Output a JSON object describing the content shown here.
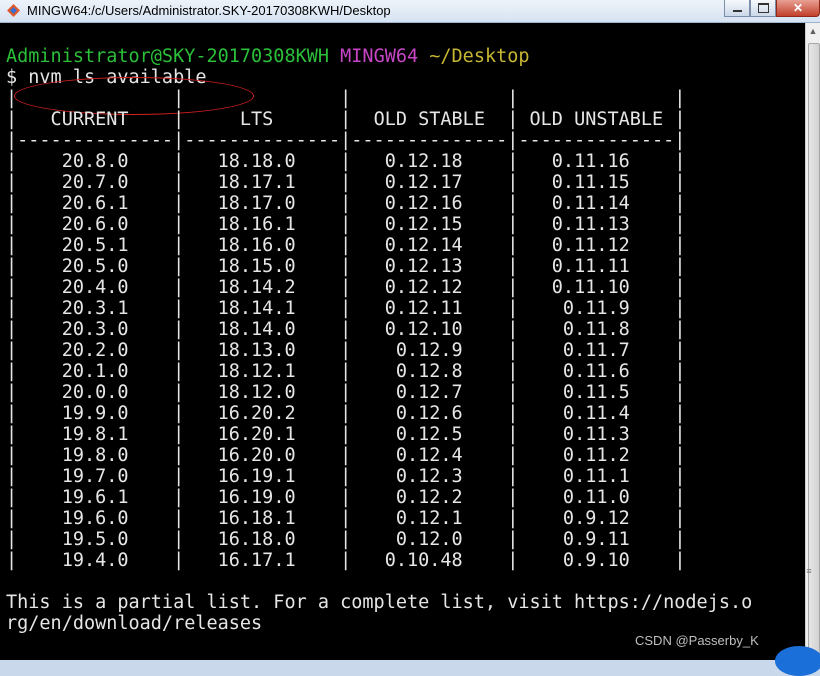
{
  "window": {
    "title": "MINGW64:/c/Users/Administrator.SKY-20170308KWH/Desktop",
    "icon": "git-bash-diamond-icon"
  },
  "prompt": {
    "user_host": "Administrator@SKY-20170308KWH",
    "env": "MINGW64",
    "path": "~/Desktop",
    "symbol": "$",
    "command": "nvm ls available"
  },
  "table": {
    "headers": [
      "CURRENT",
      "LTS",
      "OLD STABLE",
      "OLD UNSTABLE"
    ],
    "rows": [
      [
        "20.8.0",
        "18.18.0",
        "0.12.18",
        "0.11.16"
      ],
      [
        "20.7.0",
        "18.17.1",
        "0.12.17",
        "0.11.15"
      ],
      [
        "20.6.1",
        "18.17.0",
        "0.12.16",
        "0.11.14"
      ],
      [
        "20.6.0",
        "18.16.1",
        "0.12.15",
        "0.11.13"
      ],
      [
        "20.5.1",
        "18.16.0",
        "0.12.14",
        "0.11.12"
      ],
      [
        "20.5.0",
        "18.15.0",
        "0.12.13",
        "0.11.11"
      ],
      [
        "20.4.0",
        "18.14.2",
        "0.12.12",
        "0.11.10"
      ],
      [
        "20.3.1",
        "18.14.1",
        "0.12.11",
        "0.11.9"
      ],
      [
        "20.3.0",
        "18.14.0",
        "0.12.10",
        "0.11.8"
      ],
      [
        "20.2.0",
        "18.13.0",
        "0.12.9",
        "0.11.7"
      ],
      [
        "20.1.0",
        "18.12.1",
        "0.12.8",
        "0.11.6"
      ],
      [
        "20.0.0",
        "18.12.0",
        "0.12.7",
        "0.11.5"
      ],
      [
        "19.9.0",
        "16.20.2",
        "0.12.6",
        "0.11.4"
      ],
      [
        "19.8.1",
        "16.20.1",
        "0.12.5",
        "0.11.3"
      ],
      [
        "19.8.0",
        "16.20.0",
        "0.12.4",
        "0.11.2"
      ],
      [
        "19.7.0",
        "16.19.1",
        "0.12.3",
        "0.11.1"
      ],
      [
        "19.6.1",
        "16.19.0",
        "0.12.2",
        "0.11.0"
      ],
      [
        "19.6.0",
        "16.18.1",
        "0.12.1",
        "0.9.12"
      ],
      [
        "19.5.0",
        "16.18.0",
        "0.12.0",
        "0.9.11"
      ],
      [
        "19.4.0",
        "16.17.1",
        "0.10.48",
        "0.9.10"
      ]
    ]
  },
  "footer": {
    "line1": "This is a partial list. For a complete list, visit https://nodejs.o",
    "line2": "rg/en/download/releases"
  },
  "watermark": "CSDN @Passerby_K",
  "colors": {
    "user_host": "#2bbf3a",
    "env": "#c745c7",
    "path": "#c7b732",
    "text": "#e6e6e6",
    "background": "#000000",
    "annotation_circle": "#d02020"
  }
}
